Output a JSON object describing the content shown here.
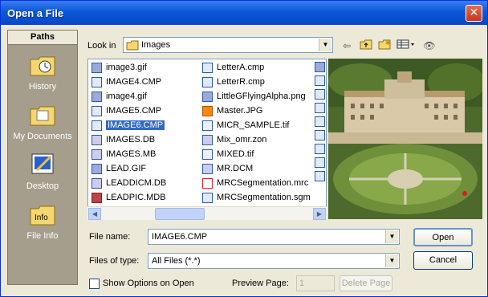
{
  "window": {
    "title": "Open a File",
    "close_label": "✕"
  },
  "paths": {
    "header": "Paths",
    "items": [
      {
        "label": "History",
        "icon": "history-folder-icon"
      },
      {
        "label": "My Documents",
        "icon": "my-documents-folder-icon"
      },
      {
        "label": "Desktop",
        "icon": "desktop-icon"
      },
      {
        "label": "File Info",
        "icon": "file-info-icon"
      }
    ]
  },
  "lookin": {
    "label": "Look in",
    "value": "Images"
  },
  "files": {
    "col1": [
      {
        "name": "image3.gif",
        "type": "gif"
      },
      {
        "name": "IMAGE4.CMP",
        "type": "cmp"
      },
      {
        "name": "image4.gif",
        "type": "gif"
      },
      {
        "name": "IMAGE5.CMP",
        "type": "cmp"
      },
      {
        "name": "IMAGE6.CMP",
        "type": "cmp",
        "selected": true
      },
      {
        "name": "IMAGES.DB",
        "type": "db"
      },
      {
        "name": "IMAGES.MB",
        "type": "db"
      },
      {
        "name": "LEAD.GIF",
        "type": "gif"
      },
      {
        "name": "LEADDICM.DB",
        "type": "db"
      },
      {
        "name": "LEADPIC.MDB",
        "type": "mdb"
      }
    ],
    "col2": [
      {
        "name": "LetterA.cmp",
        "type": "cmp"
      },
      {
        "name": "LetterR.cmp",
        "type": "cmp"
      },
      {
        "name": "LittleGFlyingAlpha.png",
        "type": "gif"
      },
      {
        "name": "Master.JPG",
        "type": "jpg"
      },
      {
        "name": "MICR_SAMPLE.tif",
        "type": "tif"
      },
      {
        "name": "Mix_omr.zon",
        "type": "db"
      },
      {
        "name": "MIXED.tif",
        "type": "tif"
      },
      {
        "name": "MR.DCM",
        "type": "db"
      },
      {
        "name": "MRCSegmentation.mrc",
        "type": "pdf"
      },
      {
        "name": "MRCSegmentation.sgm",
        "type": "cmp"
      }
    ]
  },
  "file_name": {
    "label": "File name:",
    "value": "IMAGE6.CMP"
  },
  "file_type": {
    "label": "Files of type:",
    "value": "All Files (*.*)"
  },
  "buttons": {
    "open": "Open",
    "cancel": "Cancel",
    "delete_page": "Delete Page"
  },
  "options": {
    "show_options": "Show Options on Open",
    "preview_page_label": "Preview Page:",
    "preview_page_value": "1"
  },
  "colors": {
    "title_bar": "#0a58d8",
    "selection": "#316ac5",
    "paths_panel": "#a69e8c"
  }
}
